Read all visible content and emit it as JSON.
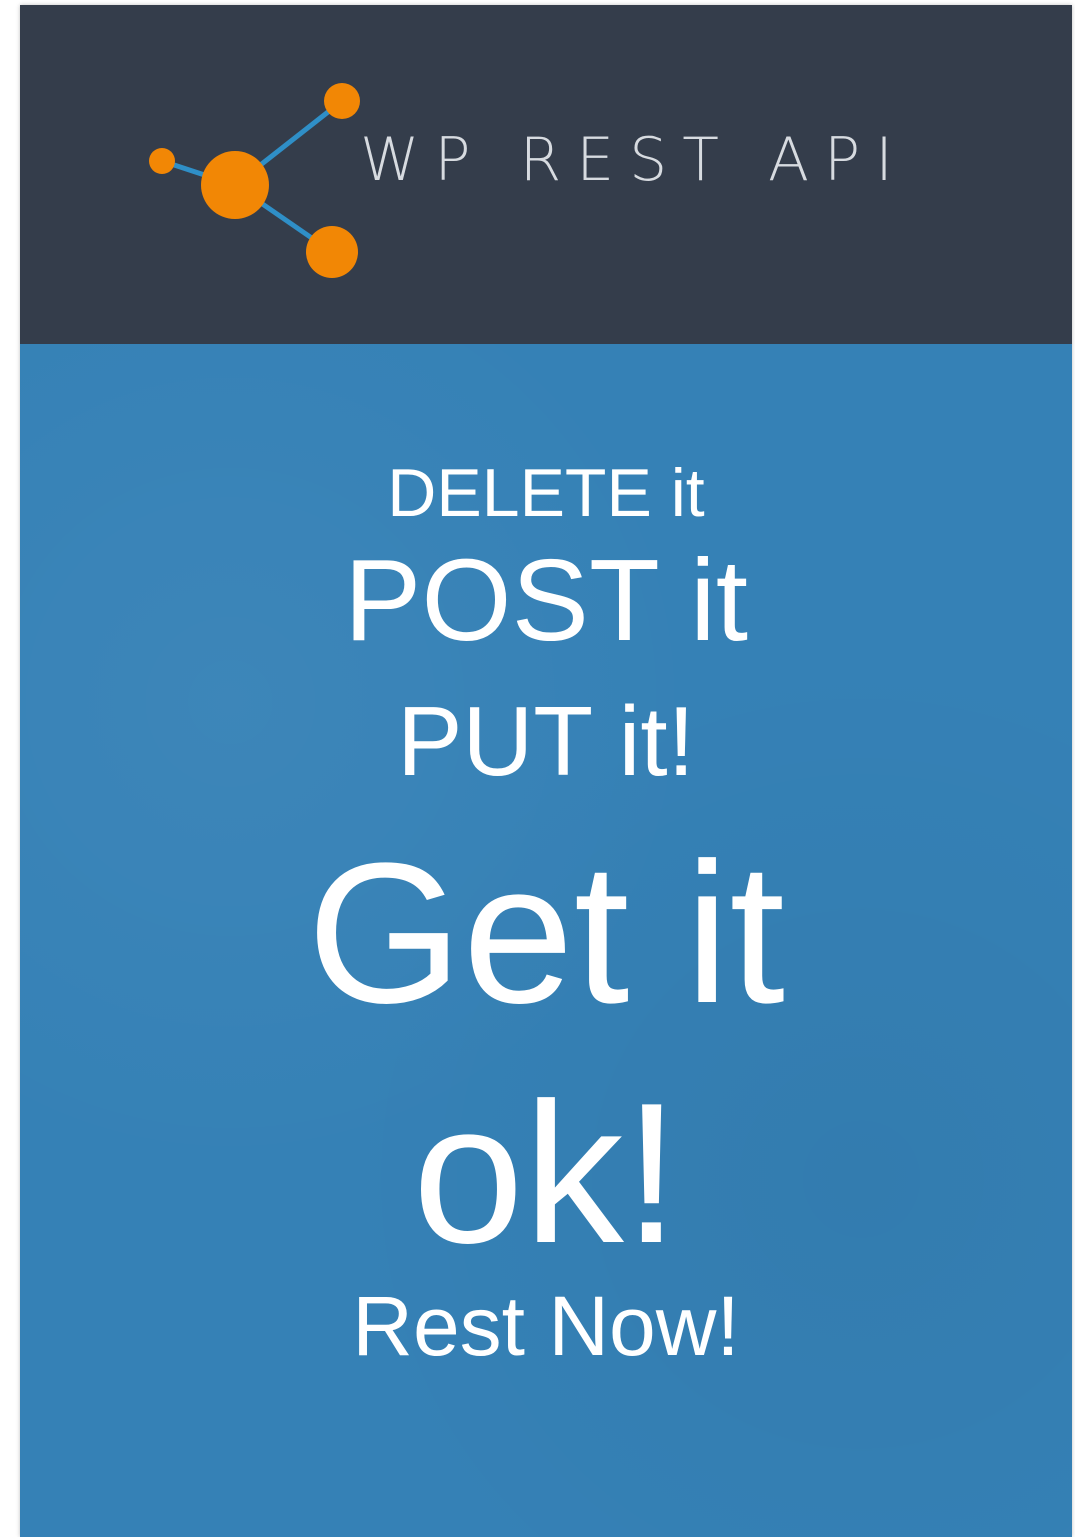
{
  "header": {
    "logo_text": "WP REST API",
    "logo_icon": "network-node-icon",
    "colors": {
      "background": "#343d4b",
      "node": "#f28705",
      "link": "#2f8fc7"
    }
  },
  "slide": {
    "background_color": "#3581b6",
    "lines": [
      "DELETE it",
      "POST it",
      "PUT it!",
      "Get it",
      "ok!",
      "Rest Now!"
    ]
  }
}
